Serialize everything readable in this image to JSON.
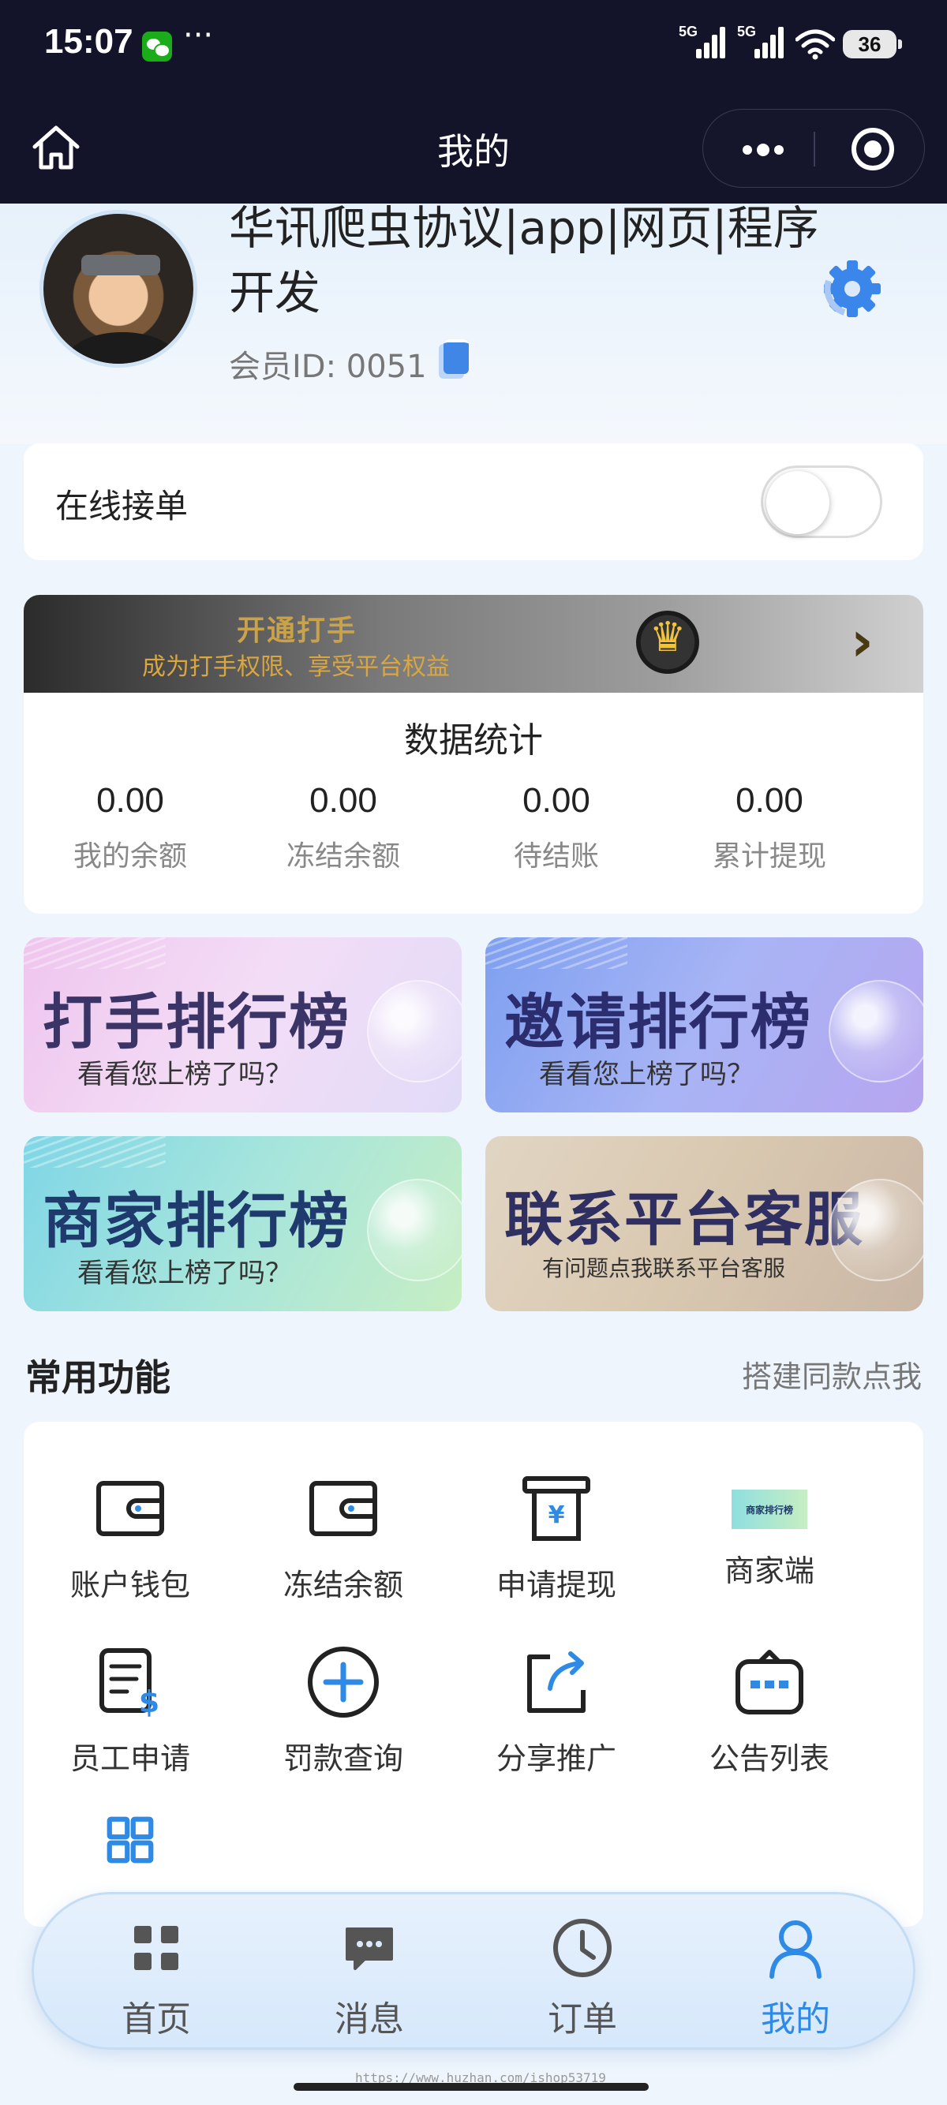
{
  "status_bar": {
    "time": "15:07",
    "dots": "···",
    "signal1": "5G",
    "signal2": "5G",
    "battery": "36"
  },
  "nav": {
    "title": "我的"
  },
  "profile": {
    "name": "华讯爬虫协议|app|网页|程序开发",
    "member_id": "会员ID: 0051"
  },
  "online": {
    "label": "在线接单",
    "enabled": false
  },
  "vip_banner": {
    "title": "开通打手",
    "subtitle": "成为打手权限、享受平台权益"
  },
  "stats": {
    "title": "数据统计",
    "items": [
      {
        "value": "0.00",
        "label": "我的余额"
      },
      {
        "value": "0.00",
        "label": "冻结余额"
      },
      {
        "value": "0.00",
        "label": "待结账"
      },
      {
        "value": "0.00",
        "label": "累计提现"
      }
    ]
  },
  "rank_tiles": [
    {
      "title": "打手排行榜",
      "subtitle": "看看您上榜了吗？"
    },
    {
      "title": "邀请排行榜",
      "subtitle": "看看您上榜了吗？"
    },
    {
      "title": "商家排行榜",
      "subtitle": "看看您上榜了吗？"
    },
    {
      "title": "联系平台客服",
      "subtitle": "有问题点我联系平台客服"
    }
  ],
  "functions": {
    "title": "常用功能",
    "link": "搭建同款点我",
    "items": [
      {
        "label": "账户钱包",
        "icon": "wallet-icon"
      },
      {
        "label": "冻结余额",
        "icon": "wallet-icon"
      },
      {
        "label": "申请提现",
        "icon": "withdraw-icon"
      },
      {
        "label": "商家端",
        "icon": "merchant-icon",
        "icon_text": "商家排行榜"
      },
      {
        "label": "员工申请",
        "icon": "employee-apply-icon"
      },
      {
        "label": "罚款查询",
        "icon": "plus-circle-icon"
      },
      {
        "label": "分享推广",
        "icon": "share-icon"
      },
      {
        "label": "公告列表",
        "icon": "notice-icon"
      },
      {
        "label": "",
        "icon": "grid-icon"
      }
    ]
  },
  "tabbar": {
    "items": [
      {
        "label": "首页",
        "icon": "grid-icon"
      },
      {
        "label": "消息",
        "icon": "message-icon"
      },
      {
        "label": "订单",
        "icon": "clock-icon"
      },
      {
        "label": "我的",
        "icon": "user-icon",
        "active": true
      }
    ]
  },
  "watermark": "https://www.huzhan.com/ishop53719",
  "colors": {
    "accent": "#2f8ae6",
    "nav_bg": "#13132a",
    "vip_gold": "#d9a640"
  }
}
